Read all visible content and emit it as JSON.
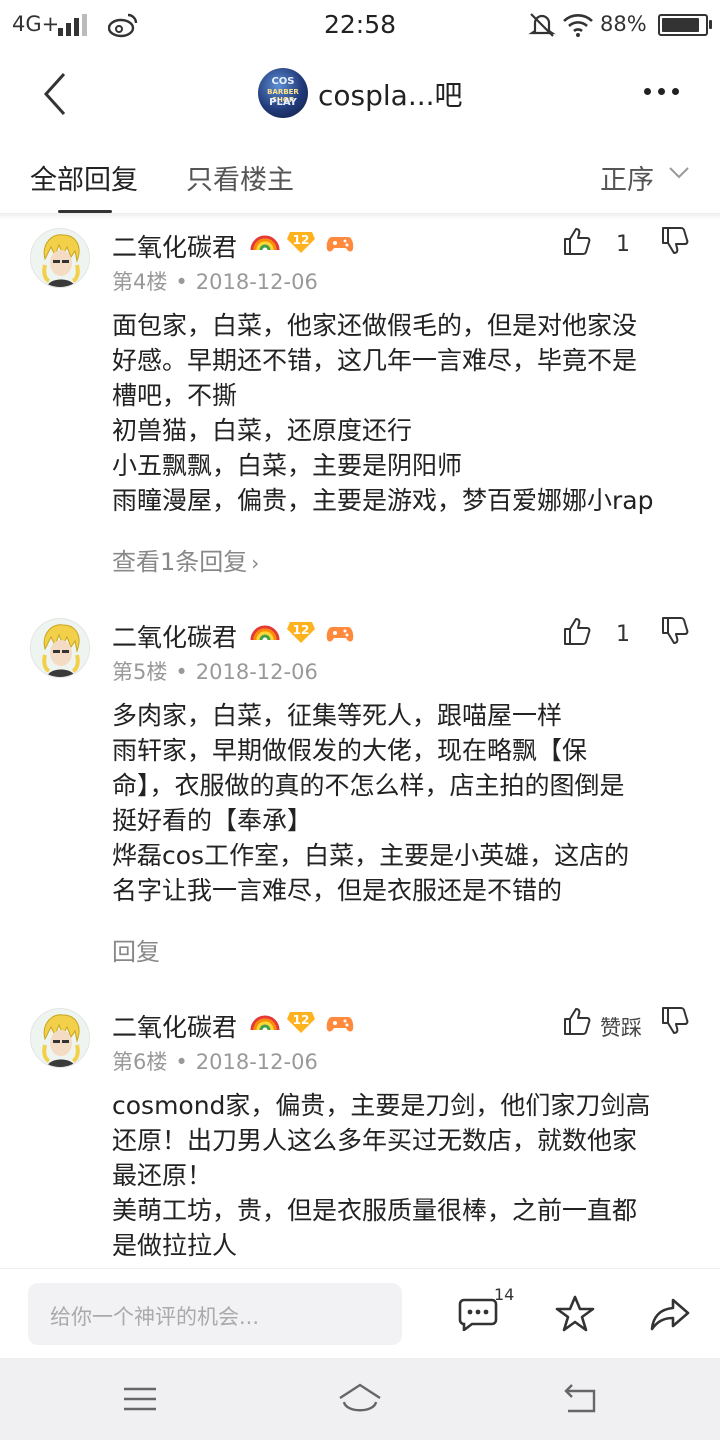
{
  "status_bar": {
    "network": "4G+",
    "time": "22:58",
    "battery_percent": "88%",
    "battery_level": 0.88
  },
  "header": {
    "forum_logo_text": [
      "COS",
      "BARBER SHOP",
      "PLAY"
    ],
    "forum_title": "cospla...吧"
  },
  "tabs": {
    "all_replies": "全部回复",
    "owner_only": "只看楼主",
    "order": "正序"
  },
  "posts": [
    {
      "author": "二氧化碳君",
      "level": "12",
      "floor": "第4楼",
      "date": "2018-12-06",
      "likes": "1",
      "content": [
        "面包家，白菜，他家还做假毛的，但是对他家没",
        "好感。早期还不错，这几年一言难尽，毕竟不是",
        "槽吧，不撕",
        "初兽猫，白菜，还原度还行",
        "小五飘飘，白菜，主要是阴阳师",
        "雨瞳漫屋，偏贵，主要是游戏，梦百爱娜娜小rap"
      ],
      "reply_link": "查看1条回复"
    },
    {
      "author": "二氧化碳君",
      "level": "12",
      "floor": "第5楼",
      "date": "2018-12-06",
      "likes": "1",
      "content": [
        "多肉家，白菜，征集等死人，跟喵屋一样",
        "雨轩家，早期做假发的大佬，现在略飘【保",
        "命】，衣服做的真的不怎么样，店主拍的图倒是",
        "挺好看的【奉承】",
        "烨磊cos工作室，白菜，主要是小英雄，这店的",
        "名字让我一言难尽，但是衣服还是不错的"
      ],
      "reply_link": "回复"
    },
    {
      "author": "二氧化碳君",
      "level": "12",
      "floor": "第6楼",
      "date": "2018-12-06",
      "like_label": "赞踩",
      "content": [
        "cosmond家，偏贵，主要是刀剑，他们家刀剑高",
        "还原！出刀男人这么多年买过无数店，就数他家",
        "最还原！",
        "美萌工坊，贵，但是衣服质量很棒，之前一直都",
        "是做拉拉人"
      ]
    }
  ],
  "comment_bar": {
    "placeholder": "给你一个神评的机会...",
    "comment_count": "14"
  }
}
